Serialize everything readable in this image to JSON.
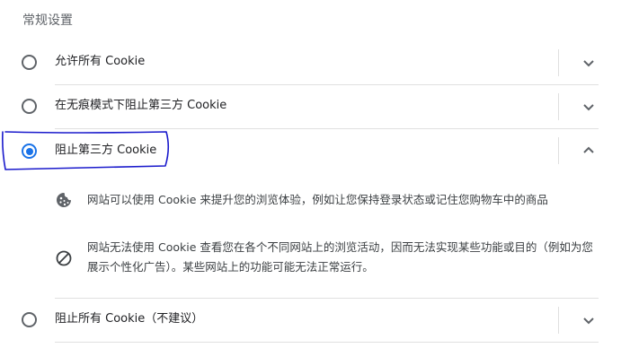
{
  "section_title": "常规设置",
  "options": [
    {
      "label": "允许所有 Cookie",
      "selected": false,
      "expanded": false
    },
    {
      "label": "在无痕模式下阻止第三方 Cookie",
      "selected": false,
      "expanded": false
    },
    {
      "label": "阻止第三方 Cookie",
      "selected": true,
      "expanded": true
    },
    {
      "label": "阻止所有 Cookie（不建议）",
      "selected": false,
      "expanded": false
    }
  ],
  "expanded_details": [
    {
      "icon": "cookie-icon",
      "text": "网站可以使用 Cookie 来提升您的浏览体验，例如让您保持登录状态或记住您购物车中的商品"
    },
    {
      "icon": "block-icon",
      "text": "网站无法使用 Cookie 查看您在各个不同网站上的浏览活动，因而无法实现某些功能或目的（例如为您展示个性化广告）。某些网站上的功能可能无法正常运行。"
    }
  ],
  "colors": {
    "accent": "#1a73e8",
    "annotation": "#1a1acc",
    "divider": "#e0e0e0"
  }
}
